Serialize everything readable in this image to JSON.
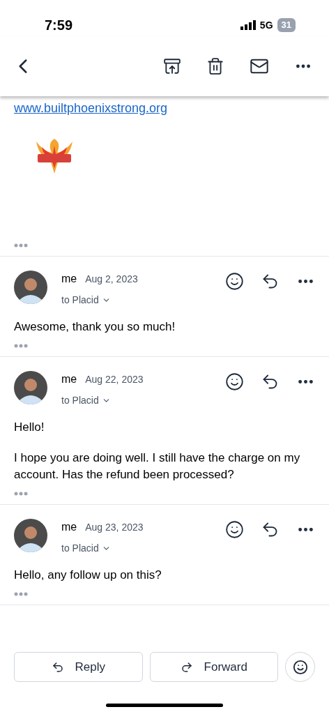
{
  "status_bar": {
    "time": "7:59",
    "network": "5G",
    "battery": "31"
  },
  "signature": {
    "link": "www.builtphoenixstrong.org"
  },
  "messages": [
    {
      "sender": "me",
      "date": "Aug 2, 2023",
      "recipient": "to Placid",
      "body": [
        "Awesome, thank you so much!"
      ]
    },
    {
      "sender": "me",
      "date": "Aug 22, 2023",
      "recipient": "to Placid",
      "body": [
        "Hello!",
        "I hope you are doing well. I still have the charge on my account. Has the refund been processed?"
      ]
    },
    {
      "sender": "me",
      "date": "Aug 23, 2023",
      "recipient": "to Placid",
      "body": [
        "Hello, any follow up on this?"
      ]
    }
  ],
  "actions": [
    "Reply",
    "Forward"
  ]
}
